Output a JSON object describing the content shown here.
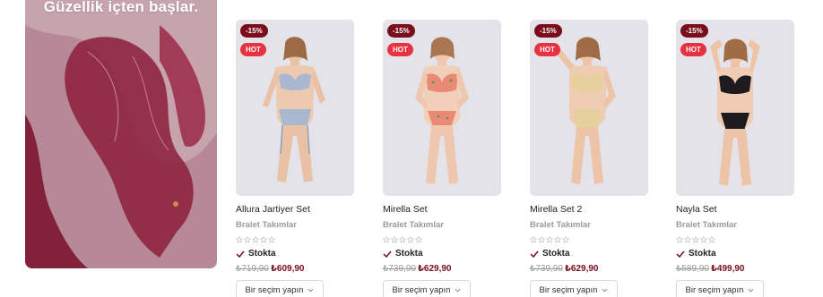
{
  "banner": {
    "title": "Güzellik içten başlar."
  },
  "products": [
    {
      "name": "Allura Jartiyer Set",
      "category": "Bralet Takımlar",
      "discount_badge": "-15%",
      "hot_badge": "HOT",
      "rating": 0,
      "rating_max": 5,
      "stock_label": "Stokta",
      "old_price": "₺719,90",
      "new_price": "₺609,90",
      "select_label": "Bir seçim yapın",
      "image": "blue-lace-lingerie-garter"
    },
    {
      "name": "Mirella Set",
      "category": "Bralet Takımlar",
      "discount_badge": "-15%",
      "hot_badge": "HOT",
      "rating": 0,
      "rating_max": 5,
      "stock_label": "Stokta",
      "old_price": "₺739,90",
      "new_price": "₺629,90",
      "select_label": "Bir seçim yapın",
      "image": "floral-coral-lingerie"
    },
    {
      "name": "Mirella Set 2",
      "category": "Bralet Takımlar",
      "discount_badge": "-15%",
      "hot_badge": "HOT",
      "rating": 0,
      "rating_max": 5,
      "stock_label": "Stokta",
      "old_price": "₺739,90",
      "new_price": "₺629,90",
      "select_label": "Bir seçim yapın",
      "image": "beige-lace-lingerie"
    },
    {
      "name": "Nayla Set",
      "category": "Bralet Takımlar",
      "discount_badge": "-15%",
      "hot_badge": "HOT",
      "rating": 0,
      "rating_max": 5,
      "stock_label": "Stokta",
      "old_price": "₺589,90",
      "new_price": "₺499,90",
      "select_label": "Bir seçim yapın",
      "image": "black-mesh-lingerie"
    }
  ],
  "colors": {
    "accent": "#7a0d1c",
    "hot": "#e8323f",
    "muted": "#9a9a9a",
    "banner": "#a86d80"
  }
}
